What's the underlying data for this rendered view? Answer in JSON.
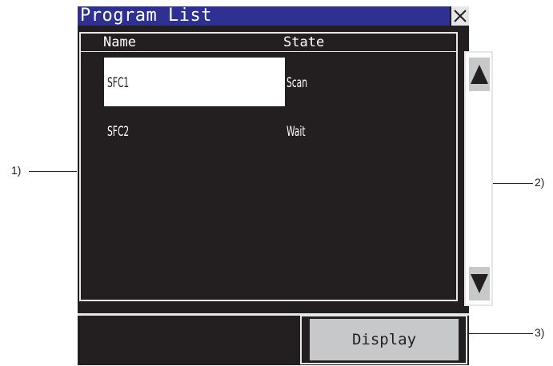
{
  "window": {
    "title": "Program List"
  },
  "list": {
    "headers": {
      "name": "Name",
      "state": "State"
    },
    "rows": [
      {
        "name": "SFC1",
        "state": "Scan",
        "selected": true
      },
      {
        "name": "SFC2",
        "state": "Wait",
        "selected": false
      }
    ]
  },
  "buttons": {
    "display": "Display"
  },
  "callouts": {
    "one": "1)",
    "two": "2)",
    "three": "3)"
  }
}
